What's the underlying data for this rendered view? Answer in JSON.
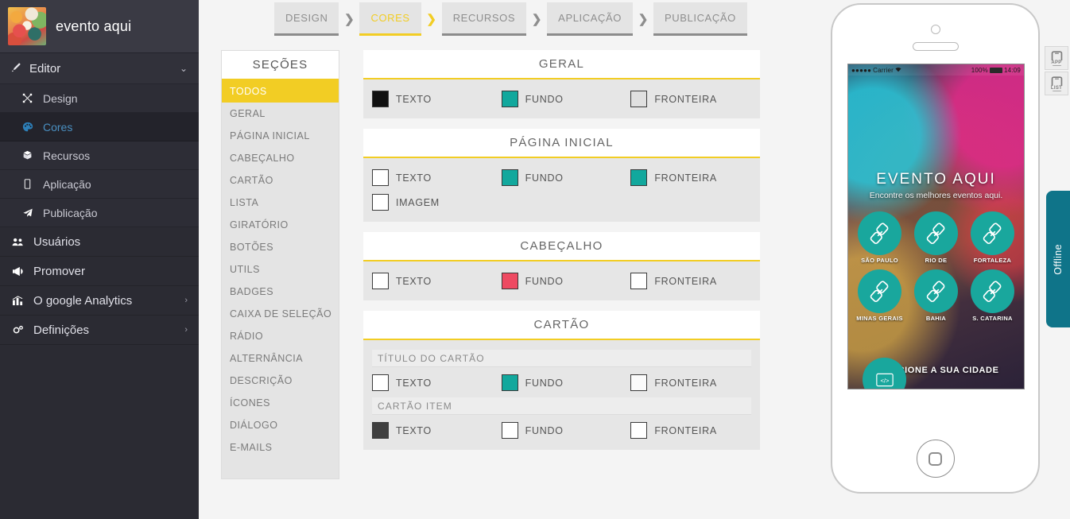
{
  "sidebar": {
    "brand": {
      "title": "evento aqui",
      "thumb_icon": "app-thumbnail"
    },
    "editor_group": {
      "label": "Editor",
      "icon": "pencil-icon",
      "chevron": "ⱽ"
    },
    "editor_items": [
      {
        "label": "Design",
        "icon": "design-icon"
      },
      {
        "label": "Cores",
        "icon": "palette-icon"
      },
      {
        "label": "Recursos",
        "icon": "box-icon"
      },
      {
        "label": "Aplicação",
        "icon": "mobile-icon"
      },
      {
        "label": "Publicação",
        "icon": "paper-plane-icon"
      }
    ],
    "main_items": [
      {
        "label": "Usuários",
        "icon": "users-icon",
        "chevron": ""
      },
      {
        "label": "Promover",
        "icon": "megaphone-icon",
        "chevron": ""
      },
      {
        "label": "O google Analytics",
        "icon": "bar-chart-icon",
        "chevron": "›"
      },
      {
        "label": "Definições",
        "icon": "gears-icon",
        "chevron": "›"
      }
    ]
  },
  "stepper": {
    "separator": "❯",
    "steps": [
      {
        "label": "DESIGN",
        "active": false
      },
      {
        "label": "CORES",
        "active": true
      },
      {
        "label": "RECURSOS",
        "active": false
      },
      {
        "label": "APLICAÇÃO",
        "active": false
      },
      {
        "label": "PUBLICAÇÃO",
        "active": false
      }
    ]
  },
  "sections": {
    "title": "SEÇÕES",
    "items": [
      {
        "label": "TODOS",
        "active": true
      },
      {
        "label": "GERAL",
        "active": false
      },
      {
        "label": "PÁGINA INICIAL",
        "active": false
      },
      {
        "label": "CABEÇALHO",
        "active": false
      },
      {
        "label": "CARTÃO",
        "active": false
      },
      {
        "label": "LISTA",
        "active": false
      },
      {
        "label": "GIRATÓRIO",
        "active": false
      },
      {
        "label": "BOTÕES",
        "active": false
      },
      {
        "label": "UTILS",
        "active": false
      },
      {
        "label": "BADGES",
        "active": false
      },
      {
        "label": "CAIXA DE SELEÇÃO",
        "active": false
      },
      {
        "label": "RÁDIO",
        "active": false
      },
      {
        "label": "ALTERNÂNCIA",
        "active": false
      },
      {
        "label": "DESCRIÇÃO",
        "active": false
      },
      {
        "label": "ÍCONES",
        "active": false
      },
      {
        "label": "DIÁLOGO",
        "active": false
      },
      {
        "label": "E-MAILS",
        "active": false
      }
    ]
  },
  "panels": [
    {
      "title": "GERAL",
      "rows": [
        [
          {
            "label": "TEXTO",
            "color": "#111111"
          },
          {
            "label": "FUNDO",
            "color": "#12a89d"
          },
          {
            "label": "FRONTEIRA",
            "color": "#e0e0e0"
          }
        ]
      ]
    },
    {
      "title": "PÁGINA INICIAL",
      "rows": [
        [
          {
            "label": "TEXTO",
            "color": "#ffffff"
          },
          {
            "label": "FUNDO",
            "color": "#12a89d"
          },
          {
            "label": "FRONTEIRA",
            "color": "#12a89d"
          }
        ],
        [
          {
            "label": "IMAGEM",
            "color": "#ffffff"
          }
        ]
      ]
    },
    {
      "title": "CABEÇALHO",
      "rows": [
        [
          {
            "label": "TEXTO",
            "color": "#ffffff"
          },
          {
            "label": "FUNDO",
            "color": "#ee4a62"
          },
          {
            "label": "FRONTEIRA",
            "color": "#ffffff"
          }
        ]
      ]
    },
    {
      "title": "CARTÃO",
      "groups": [
        {
          "subtitle": "TÍTULO DO CARTÃO",
          "rows": [
            [
              {
                "label": "TEXTO",
                "color": "#ffffff"
              },
              {
                "label": "FUNDO",
                "color": "#12a89d"
              },
              {
                "label": "FRONTEIRA",
                "color": "#fbfbfb"
              }
            ]
          ]
        },
        {
          "subtitle": "CARTÃO ITEM",
          "rows": [
            [
              {
                "label": "TEXTO",
                "color": "#3f3f3f"
              },
              {
                "label": "FUNDO",
                "color": "#ffffff"
              },
              {
                "label": "FRONTEIRA",
                "color": "#ffffff"
              }
            ]
          ]
        }
      ]
    }
  ],
  "preview": {
    "statusbar": {
      "dots": "●●●●●",
      "carrier": "Carrier",
      "wifi": "▾",
      "battery_pct": "100%",
      "time": "14:09"
    },
    "hero_title": "EVENTO AQUI",
    "hero_sub": "Encontre os melhores eventos aqui.",
    "cities": [
      {
        "name": "SÃO PAULO"
      },
      {
        "name": "RIO DE"
      },
      {
        "name": "FORTALEZA"
      },
      {
        "name": "MINAS GERAIS"
      },
      {
        "name": "BAHIA"
      },
      {
        "name": "S. CATARINA"
      }
    ],
    "select_city": "SELECIONE A SUA CIDADE",
    "code_bubble": "</>"
  },
  "rail": {
    "buttons": [
      {
        "label": "APP",
        "icon": "phone-app-icon"
      },
      {
        "label": "LIST",
        "icon": "phone-list-icon"
      }
    ],
    "offline_label": "Offline"
  },
  "colors": {
    "accent_yellow": "#f2cd24",
    "teal": "#12a89d",
    "red": "#ee4a62",
    "offline_teal": "#0f7489",
    "sidebar_bg": "#2b2b33"
  }
}
